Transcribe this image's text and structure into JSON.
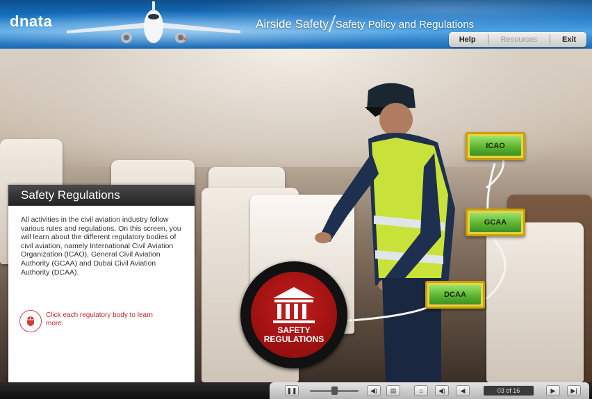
{
  "header": {
    "logo_text": "dnata",
    "course_title": "Airside Safety",
    "topic_title": "Safety Policy and Regulations",
    "buttons": {
      "help": "Help",
      "resources": "Resources",
      "exit": "Exit"
    }
  },
  "panel": {
    "heading": "Safety Regulations",
    "body": "All activities in the civil aviation industry follow various rules and regulations. On this screen, you will learn about the different regulatory bodies of civil aviation, namely International Civil Aviation Organization (ICAO), General Civil Aviation Authority (GCAA) and Dubai Civil Aviation Authority (DCAA).",
    "hint": "Click each regulatory body to learn more."
  },
  "badge": {
    "line1": "SAFETY",
    "line2": "REGULATIONS"
  },
  "regulators": [
    {
      "label": "ICAO"
    },
    {
      "label": "GCAA"
    },
    {
      "label": "DCAA"
    }
  ],
  "player": {
    "counter": "03 of 16",
    "slider_fraction": 0.5
  },
  "colors": {
    "accent_green": "#5cb531",
    "accent_gold": "#c8a100",
    "badge_red": "#9a1010",
    "header_blue": "#1572c4",
    "hint_red": "#c0262b"
  }
}
